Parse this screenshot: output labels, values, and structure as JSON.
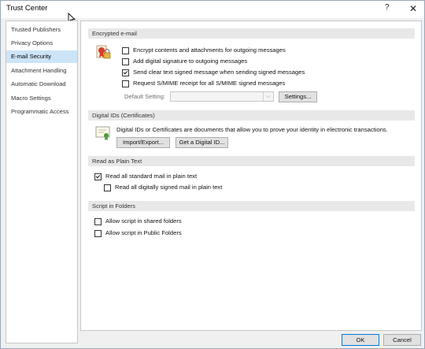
{
  "window": {
    "title": "Trust Center",
    "help_glyph": "?",
    "close_glyph": "✕"
  },
  "sidebar": {
    "items": [
      {
        "label": "Trusted Publishers"
      },
      {
        "label": "Privacy Options"
      },
      {
        "label": "E-mail Security"
      },
      {
        "label": "Attachment Handling"
      },
      {
        "label": "Automatic Download"
      },
      {
        "label": "Macro Settings"
      },
      {
        "label": "Programmatic Access"
      }
    ],
    "active_index": 2
  },
  "sections": {
    "encrypted": {
      "header": "Encrypted e-mail",
      "options": [
        {
          "label": "Encrypt contents and attachments for outgoing messages",
          "checked": false
        },
        {
          "label": "Add digital signature to outgoing messages",
          "checked": false
        },
        {
          "label": "Send clear text signed message when sending signed messages",
          "checked": true
        },
        {
          "label": "Request S/MIME receipt for all S/MIME signed messages",
          "checked": false
        }
      ],
      "default_setting_label": "Default Setting:",
      "default_setting_value": "",
      "settings_button": "Settings..."
    },
    "digital_ids": {
      "header": "Digital IDs (Certificates)",
      "description": "Digital IDs or Certificates are documents that allow you to prove your identity in electronic transactions.",
      "import_export_button": "Import/Export...",
      "get_id_button": "Get a Digital ID..."
    },
    "plain_text": {
      "header": "Read as Plain Text",
      "options": [
        {
          "label": "Read all standard mail in plain text",
          "checked": true
        },
        {
          "label": "Read all digitally signed mail in plain text",
          "checked": false
        }
      ]
    },
    "script": {
      "header": "Script in Folders",
      "options": [
        {
          "label": "Allow script in shared folders",
          "checked": false
        },
        {
          "label": "Allow script in Public Folders",
          "checked": false
        }
      ]
    }
  },
  "footer": {
    "ok": "OK",
    "cancel": "Cancel"
  }
}
